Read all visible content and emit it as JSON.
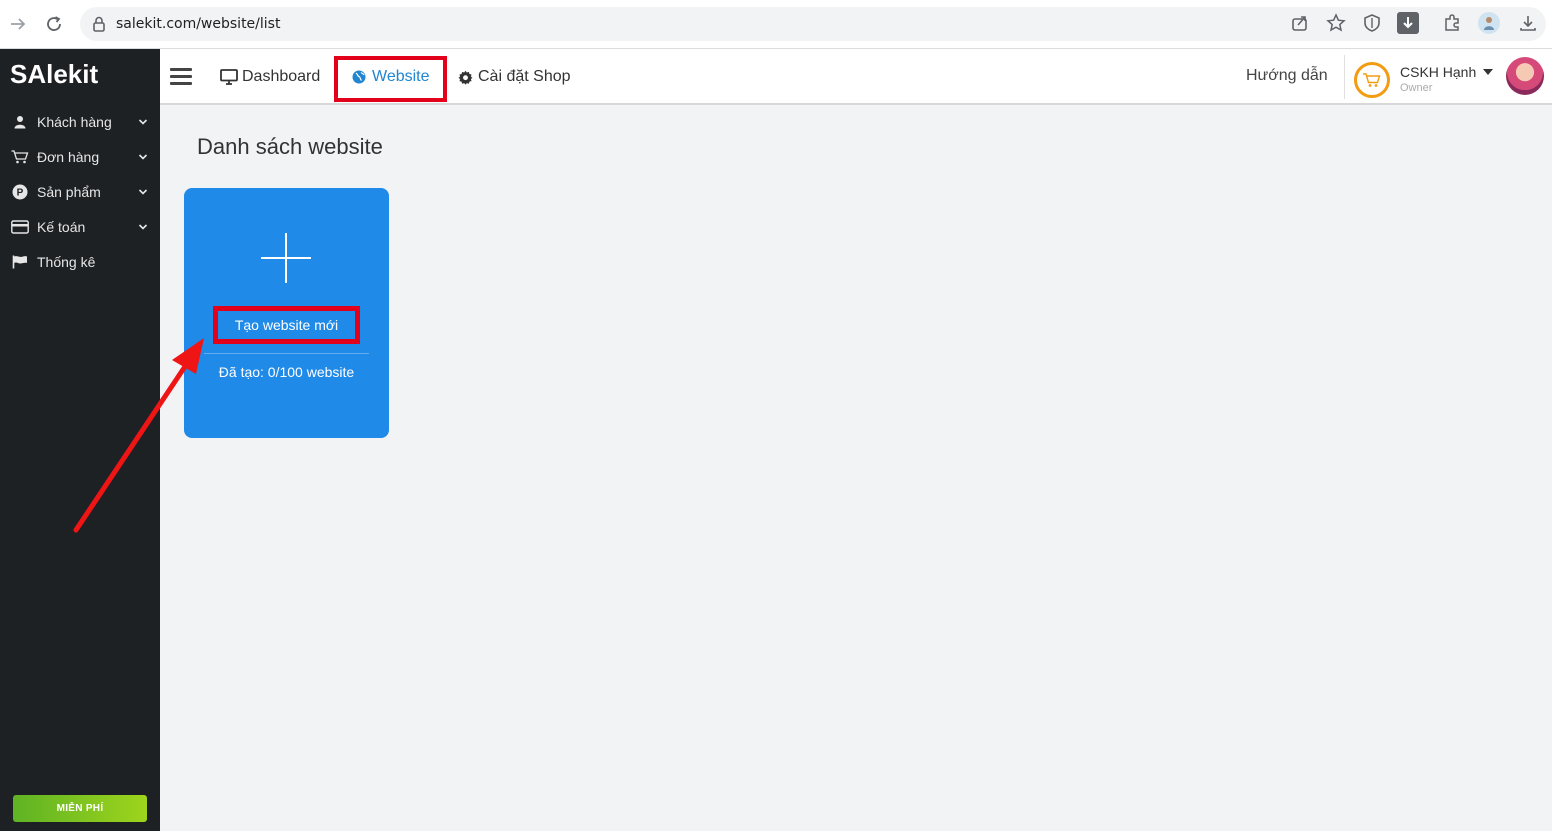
{
  "browser": {
    "url": "salekit.com/website/list"
  },
  "sidebar": {
    "logo": "SAlekit",
    "items": [
      {
        "label": "Khách hàng",
        "icon": "user-icon",
        "has_chevron": true
      },
      {
        "label": "Đơn hàng",
        "icon": "cart-icon",
        "has_chevron": true
      },
      {
        "label": "Sản phẩm",
        "icon": "product-p-icon",
        "has_chevron": true
      },
      {
        "label": "Kế toán",
        "icon": "credit-card-icon",
        "has_chevron": true
      },
      {
        "label": "Thống kê",
        "icon": "flag-icon",
        "has_chevron": false
      }
    ],
    "free_button": "MIỄN PHÍ"
  },
  "header": {
    "nav": [
      {
        "label": "Dashboard",
        "icon": "monitor-icon"
      },
      {
        "label": "Website",
        "icon": "globe-icon",
        "active": true
      },
      {
        "label": "Cài đặt Shop",
        "icon": "gear-icon"
      }
    ],
    "guide": "Hướng dẫn",
    "user": {
      "name": "CSKH Hạnh",
      "role": "Owner"
    }
  },
  "main": {
    "title": "Danh sách website",
    "card": {
      "button": "Tạo website mới",
      "count_text": "Đã tạo: 0/100 website"
    }
  },
  "colors": {
    "sidebar_bg": "#1e2124",
    "card_bg": "#208ae8",
    "accent": "#2285d0",
    "highlight": "#e3001b",
    "free_green": "#7cc11f"
  }
}
